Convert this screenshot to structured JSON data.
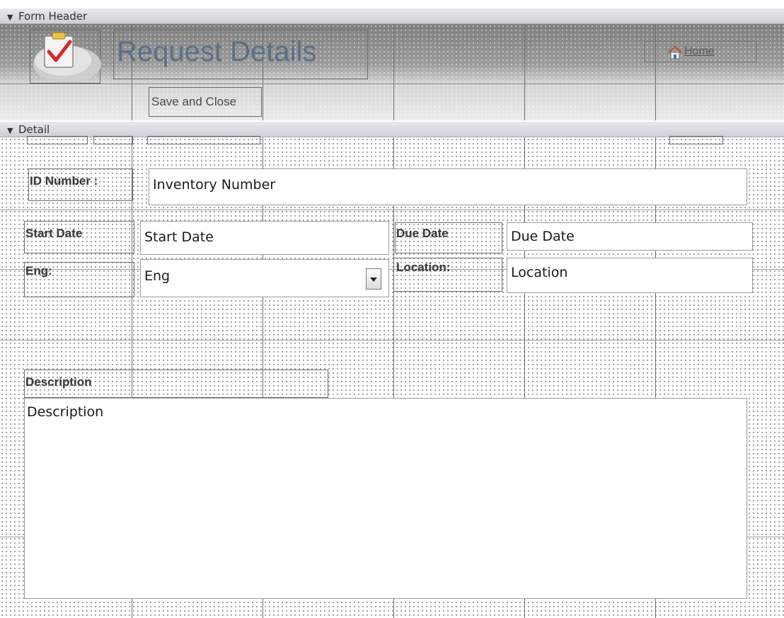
{
  "sections": {
    "form_header": "Form Header",
    "detail": "Detail"
  },
  "header": {
    "title": "Request Details",
    "home_label": "Home",
    "save_close_label": "Save and Close",
    "logo_icon": "clipboard-check-icon",
    "home_icon": "house-icon"
  },
  "form": {
    "id_label": "ID Number :",
    "id_value": "Inventory Number",
    "start_label": "Start Date",
    "start_value": "Start Date",
    "due_label": "Due Date",
    "due_value": "Due Date",
    "eng_label": "Eng:",
    "eng_value": "Eng",
    "location_label": "Location:",
    "location_value": "Location",
    "description_label": "Description",
    "description_value": "Description"
  },
  "colors": {
    "title": "#5b6f86",
    "check_red": "#d6282a",
    "grid_line": "#6e6e6e"
  }
}
